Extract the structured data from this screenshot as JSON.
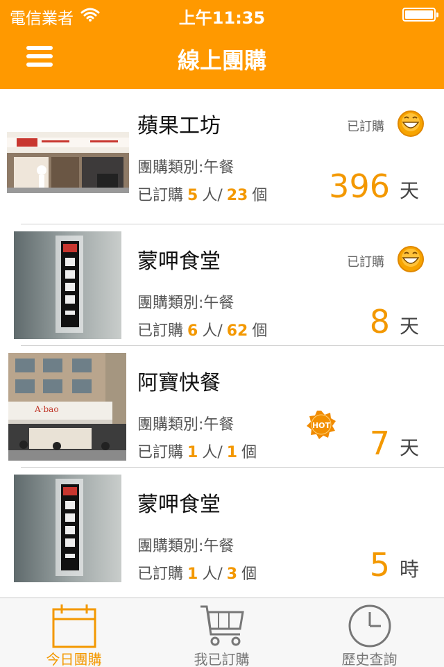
{
  "status_bar": {
    "carrier": "電信業者",
    "time": "上午11:35"
  },
  "nav": {
    "title": "線上團購",
    "menu_icon": "hamburger-menu-icon"
  },
  "colors": {
    "accent": "#ff9900",
    "number": "#f39800"
  },
  "list": {
    "items": [
      {
        "name": "蘋果工坊",
        "status": "已訂購",
        "status_icon": "smiley-icon",
        "category": "團購類別:午餐",
        "ordered_label": "已訂購",
        "people": "5",
        "people_unit": "人/",
        "quantity": "23",
        "quantity_unit": "個",
        "remaining": "396",
        "remaining_unit": "天",
        "hot": false
      },
      {
        "name": "蒙呷食堂",
        "status": "已訂購",
        "status_icon": "smiley-icon",
        "category": "團購類別:午餐",
        "ordered_label": "已訂購",
        "people": "6",
        "people_unit": "人/",
        "quantity": "62",
        "quantity_unit": "個",
        "remaining": "8",
        "remaining_unit": "天",
        "hot": false
      },
      {
        "name": "阿寶快餐",
        "status": "",
        "category": "團購類別:午餐",
        "ordered_label": "已訂購",
        "people": "1",
        "people_unit": "人/",
        "quantity": "1",
        "quantity_unit": "個",
        "remaining": "7",
        "remaining_unit": "天",
        "hot": true,
        "hot_label": "HOT",
        "sign_text": "A·bao"
      },
      {
        "name": "蒙呷食堂",
        "status": "",
        "category": "團購類別:午餐",
        "ordered_label": "已訂購",
        "people": "1",
        "people_unit": "人/",
        "quantity": "3",
        "quantity_unit": "個",
        "remaining": "5",
        "remaining_unit": "時",
        "hot": false
      }
    ]
  },
  "tabs": [
    {
      "label": "今日團購",
      "icon": "calendar-icon",
      "active": true
    },
    {
      "label": "我已訂購",
      "icon": "cart-icon",
      "active": false
    },
    {
      "label": "歷史查詢",
      "icon": "clock-icon",
      "active": false
    }
  ]
}
